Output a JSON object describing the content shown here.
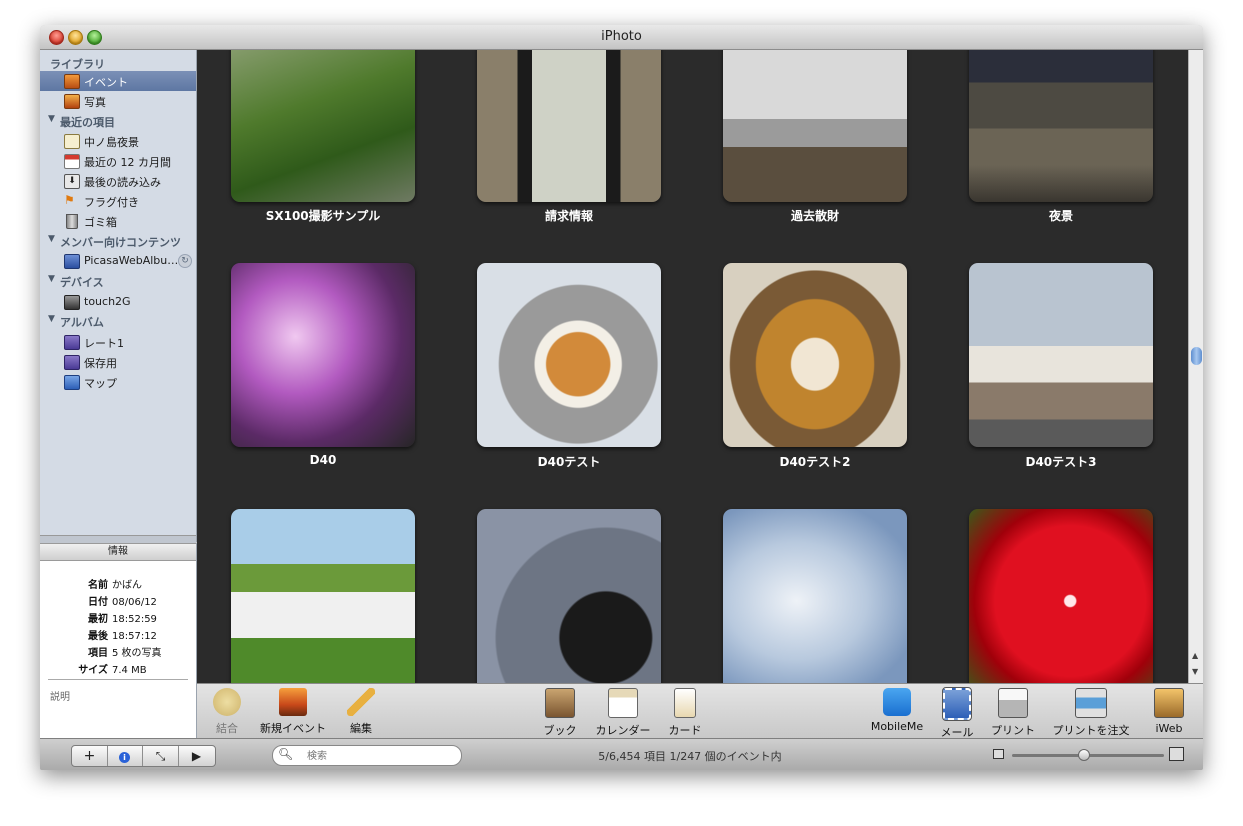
{
  "window": {
    "title": "iPhoto"
  },
  "sidebar": {
    "sections": {
      "library": "ライブラリ",
      "recent": "最近の項目",
      "members": "メンバー向けコンテンツ",
      "devices": "デバイス",
      "albums": "アルバム"
    },
    "library_items": [
      {
        "label": "イベント",
        "icon": "events-icon",
        "selected": true
      },
      {
        "label": "写真",
        "icon": "photos-icon",
        "selected": false
      }
    ],
    "recent_items": [
      {
        "label": "中ノ島夜景",
        "icon": "event-icon"
      },
      {
        "label": "最近の 12 カ月間",
        "icon": "calendar-icon"
      },
      {
        "label": "最後の読み込み",
        "icon": "import-icon"
      },
      {
        "label": "フラグ付き",
        "icon": "flag-icon"
      },
      {
        "label": "ゴミ箱",
        "icon": "trash-icon"
      }
    ],
    "member_items": [
      {
        "label": "PicasaWebAlbu…",
        "icon": "web-album-icon"
      }
    ],
    "device_items": [
      {
        "label": "touch2G",
        "icon": "camera-icon"
      }
    ],
    "album_items": [
      {
        "label": "レート1",
        "icon": "smart-album-icon"
      },
      {
        "label": "保存用",
        "icon": "smart-album-icon"
      },
      {
        "label": "マップ",
        "icon": "album-icon"
      }
    ]
  },
  "info": {
    "header": "情報",
    "fields": [
      {
        "key": "名前",
        "value": "かばん"
      },
      {
        "key": "日付",
        "value": "08/06/12"
      },
      {
        "key": "最初",
        "value": "18:52:59"
      },
      {
        "key": "最後",
        "value": "18:57:12"
      },
      {
        "key": "項目",
        "value": "5 枚の写真"
      },
      {
        "key": "サイズ",
        "value": "7.4 MB"
      }
    ],
    "description_label": "説明"
  },
  "events": [
    {
      "title": "SX100撮影サンプル",
      "icon": "plant-photo"
    },
    {
      "title": "請求情報",
      "icon": "phone-screen-photo"
    },
    {
      "title": "過去散財",
      "icon": "printer-photo"
    },
    {
      "title": "夜景",
      "icon": "night-city-photo"
    },
    {
      "title": "D40",
      "icon": "camera-photo"
    },
    {
      "title": "D40テスト",
      "icon": "plush-dog-photo"
    },
    {
      "title": "D40テスト2",
      "icon": "plush-lion-photo"
    },
    {
      "title": "D40テスト3",
      "icon": "buildings-photo"
    },
    {
      "title": "",
      "icon": "castle-photo"
    },
    {
      "title": "",
      "icon": "remote-filter-photo"
    },
    {
      "title": "",
      "icon": "sky-photo"
    },
    {
      "title": "",
      "icon": "red-flower-photo"
    }
  ],
  "toolbar": {
    "merge": "結合",
    "new_event": "新規イベント",
    "edit": "編集",
    "book": "ブック",
    "calendar": "カレンダー",
    "card": "カード",
    "mobileme": "MobileMe",
    "mail": "メール",
    "print": "プリント",
    "order_prints": "プリントを注文",
    "iweb": "iWeb"
  },
  "bottombar": {
    "add_symbol": "+",
    "info_symbol": "i",
    "fullscreen_symbol": "⤡",
    "play_symbol": "▶",
    "search_placeholder": "検索",
    "status": "5/6,454 項目 1/247 個のイベント内"
  }
}
